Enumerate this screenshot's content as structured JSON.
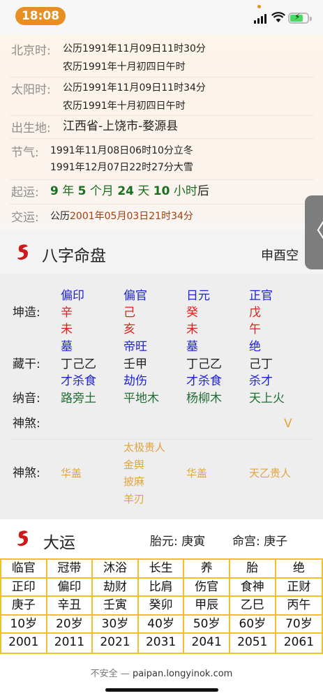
{
  "status_bar": {
    "time": "18:08",
    "battery_icon": "battery-charging-icon"
  },
  "info": {
    "beijing": {
      "label": "北京时:",
      "solar": "公历1991年11月09日11时30分",
      "lunar": "农历1991年十月初四日午时"
    },
    "solar_time": {
      "label": "太阳时:",
      "solar": "公历1991年11月09日11时34分",
      "lunar": "农历1991年十月初四日午时"
    },
    "birthplace": {
      "label": "出生地:",
      "value": "江西省-上饶市-婺源县"
    },
    "jieqi": {
      "label": "节气:",
      "line1": "1991年11月08日06时10分立冬",
      "line2": "1991年12月07日22时27分大雪"
    },
    "qiyun": {
      "label": "起运:",
      "y": "9",
      "y_unit": "年",
      "m": "5",
      "m_unit": "个月",
      "d": "24",
      "d_unit": "天",
      "h": "10",
      "h_unit": "小时",
      "suffix": "后"
    },
    "jiaoyun": {
      "label": "交运:",
      "prefix": "公历",
      "date": "2001年05月03日21时34分"
    }
  },
  "bazi": {
    "title": "八字命盘",
    "kong": "申酉空",
    "label_kunzao": "坤造:",
    "label_canggan": "藏干:",
    "label_nayin": "纳音:",
    "label_shensha": "神煞:",
    "shensha_toggle": "V",
    "columns": [
      {
        "shishen": "偏印",
        "gan": "辛",
        "zhi": "未",
        "state": "墓",
        "canggan": "丁己乙",
        "canggan_shishen": "才杀食",
        "nayin": "路旁土",
        "shensha": [
          "华盖"
        ]
      },
      {
        "shishen": "偏官",
        "gan": "己",
        "zhi": "亥",
        "state": "帝旺",
        "canggan": "壬甲",
        "canggan_shishen": "劫伤",
        "nayin": "平地木",
        "shensha": [
          "太极贵人",
          "金舆",
          "披麻",
          "羊刃"
        ]
      },
      {
        "shishen": "日元",
        "gan": "癸",
        "zhi": "未",
        "state": "墓",
        "canggan": "丁己乙",
        "canggan_shishen": "才杀食",
        "nayin": "杨柳木",
        "shensha": [
          "华盖"
        ]
      },
      {
        "shishen": "正官",
        "gan": "戊",
        "zhi": "午",
        "state": "绝",
        "canggan": "己丁",
        "canggan_shishen": "杀才",
        "nayin": "天上火",
        "shensha": [
          "天乙贵人"
        ]
      }
    ],
    "colors": {
      "shishen": "#1f23d8",
      "ganzhi": "#e0201e",
      "nayin": "#1f6e34",
      "shensha": "#e2a43c"
    }
  },
  "dayun": {
    "title": "大运",
    "taiyuan_label": "胎元:",
    "taiyuan": "庚寅",
    "minggong_label": "命宫:",
    "minggong": "庚子",
    "rows": [
      [
        "临官",
        "冠带",
        "沐浴",
        "长生",
        "养",
        "胎",
        "绝"
      ],
      [
        "正印",
        "偏印",
        "劫财",
        "比肩",
        "伤官",
        "食神",
        "正财"
      ],
      [
        "庚子",
        "辛丑",
        "壬寅",
        "癸卯",
        "甲辰",
        "乙巳",
        "丙午"
      ],
      [
        "10岁",
        "20岁",
        "30岁",
        "40岁",
        "50岁",
        "60岁",
        "70岁"
      ],
      [
        "2001",
        "2011",
        "2021",
        "2031",
        "2041",
        "2051",
        "2061"
      ]
    ],
    "border_color": "#f2c02c"
  },
  "browser": {
    "insecure": "不安全 —",
    "domain": "paipan.longyinok.com"
  },
  "side_tab": {
    "glyph": "〈"
  }
}
